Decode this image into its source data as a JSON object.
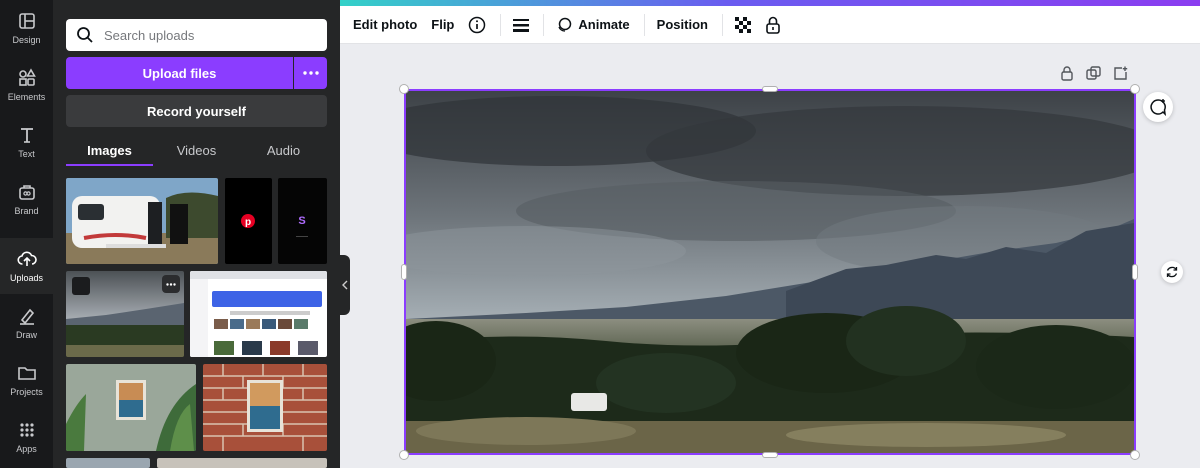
{
  "rail": [
    {
      "label": "Design",
      "icon": "design-icon"
    },
    {
      "label": "Elements",
      "icon": "elements-icon"
    },
    {
      "label": "Text",
      "icon": "text-icon"
    },
    {
      "label": "Brand",
      "icon": "brand-icon"
    },
    {
      "label": "Uploads",
      "icon": "uploads-icon",
      "active": true
    },
    {
      "label": "Draw",
      "icon": "draw-icon"
    },
    {
      "label": "Projects",
      "icon": "projects-icon"
    },
    {
      "label": "Apps",
      "icon": "apps-icon"
    }
  ],
  "panel": {
    "search_placeholder": "Search uploads",
    "upload_label": "Upload files",
    "record_label": "Record yourself",
    "tabs": [
      {
        "label": "Images",
        "active": true
      },
      {
        "label": "Videos"
      },
      {
        "label": "Audio"
      }
    ],
    "thumb_letter": "S"
  },
  "toolbar": {
    "edit_photo": "Edit photo",
    "flip": "Flip",
    "animate": "Animate",
    "position": "Position"
  },
  "colors": {
    "accent": "#8b3dff",
    "panel_bg": "#252627",
    "rail_bg": "#18191b",
    "canvas_bg": "#ebecf0"
  }
}
